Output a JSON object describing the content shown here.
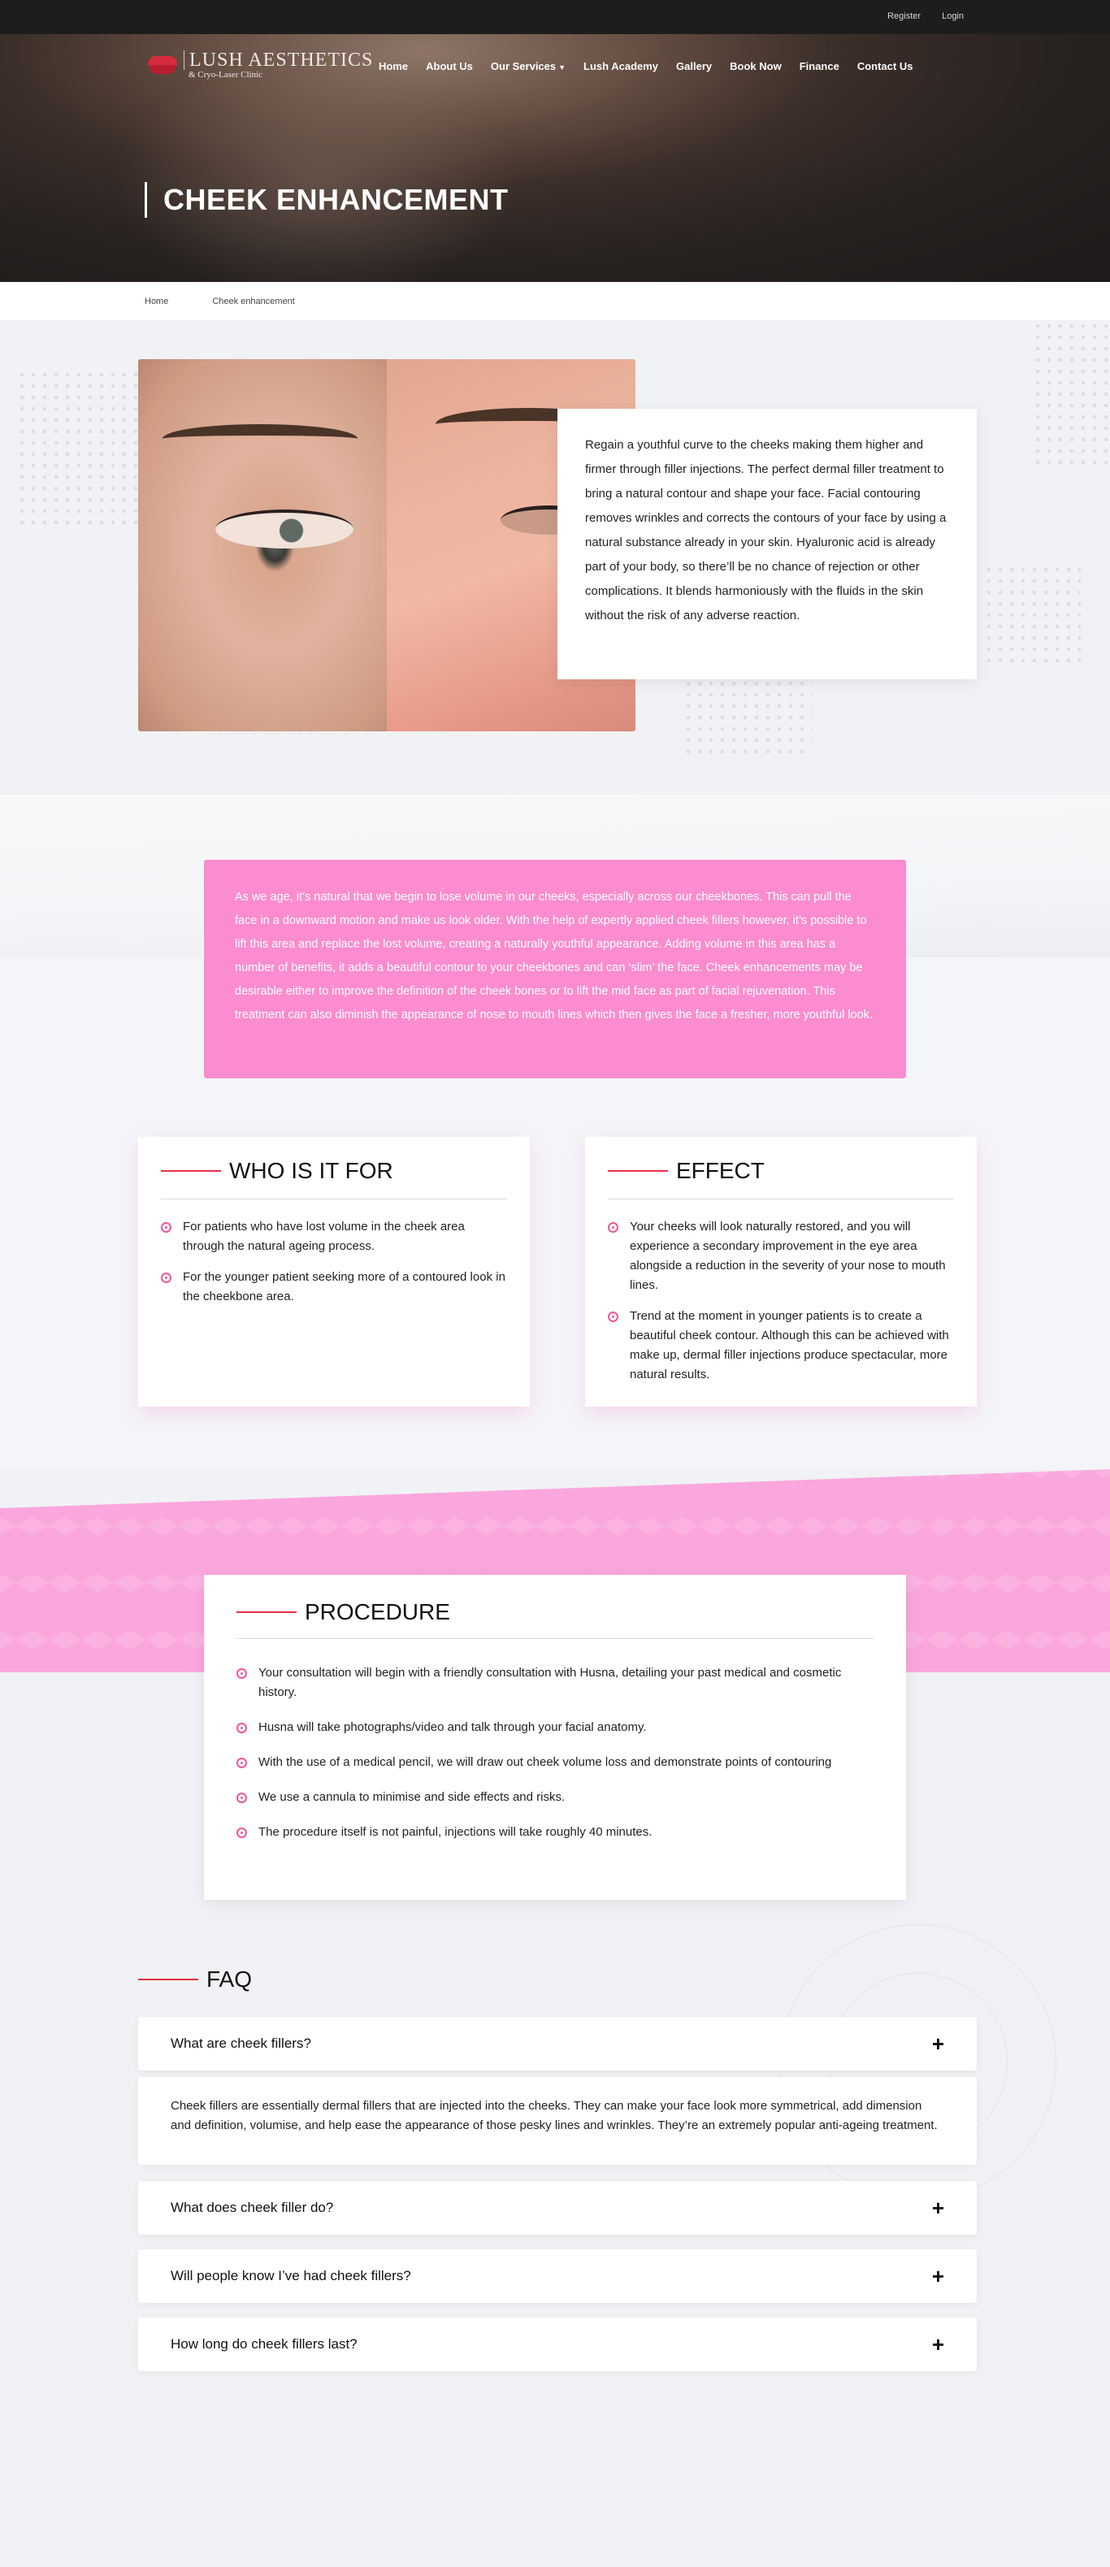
{
  "topbar": {
    "register": "Register",
    "login": "Login"
  },
  "logo": {
    "line1": "LUSH AESTHETICS",
    "line2": "& Cryo-Laser Clinic"
  },
  "nav": {
    "items": [
      "Home",
      "About Us",
      "Our Services",
      "Lush Academy",
      "Gallery",
      "Book Now",
      "Finance",
      "Contact Us"
    ],
    "dropdown_item": "Our Services"
  },
  "hero": {
    "title": "CHEEK ENHANCEMENT"
  },
  "breadcrumb": {
    "home": "Home",
    "current": "Cheek enhancement"
  },
  "intro": {
    "text": "Regain a youthful curve to the cheeks making them higher and firmer through filler injections. The perfect dermal filler treatment to bring a natural contour and shape your face. Facial contouring removes wrinkles and corrects the contours of your face by using a natural substance already in your skin. Hyaluronic acid is already part of your body, so there’ll be no chance of rejection or other complications. It blends harmoniously with the fluids in the skin without the risk of any adverse reaction."
  },
  "pink_info": {
    "text": "As we age, it’s natural that we begin to lose volume in our cheeks, especially across our cheekbones. This can pull the face in a downward motion and make us look older. With the help of expertly applied cheek fillers however, it’s possible to lift this area and replace the lost volume, creating a naturally youthful appearance. Adding volume in this area has a number of benefits, it adds a beautiful contour to your cheekbones and can ‘slim’ the face. Cheek enhancements may be desirable either to improve the definition of the cheek bones or to lift the mid face as part of facial rejuvenation. This treatment can also diminish the appearance of nose to mouth lines which then gives the face a fresher, more youthful look."
  },
  "who": {
    "title": "WHO IS IT FOR",
    "items": [
      "For patients who have lost volume in the cheek area through the natural ageing process.",
      "For the younger patient seeking more of a contoured look in the cheekbone area."
    ]
  },
  "effect": {
    "title": "EFFECT",
    "items": [
      "Your cheeks will look naturally restored, and you will experience a secondary improvement in the eye area alongside a reduction in the severity of your nose to mouth lines.",
      "Trend at the moment in younger patients is to create a beautiful cheek contour. Although this can be achieved with make up, dermal filler injections produce spectacular, more natural results."
    ]
  },
  "procedure": {
    "title": "PROCEDURE",
    "items": [
      "Your consultation will begin with a friendly consultation with Husna, detailing your past medical and cosmetic history.",
      "Husna will take photographs/video and talk through your facial anatomy.",
      "With the use of a medical pencil, we will draw out cheek volume loss and demonstrate points of contouring",
      "We use a cannula to minimise and side effects and risks.",
      "The procedure itself is not painful, injections will take roughly 40 minutes."
    ]
  },
  "faq": {
    "title": "FAQ",
    "items": [
      {
        "question": "What are cheek fillers?",
        "answer": "Cheek fillers are essentially dermal fillers that are injected into the cheeks. They can make your face look more symmetrical, add dimension and definition, volumise, and help ease the appearance of those pesky lines and wrinkles. They’re an extremely popular anti-ageing treatment."
      },
      {
        "question": "What does cheek filler do?"
      },
      {
        "question": "Will people know I’ve had cheek fillers?"
      },
      {
        "question": "How long do cheek fillers last?"
      }
    ],
    "toggle_icon": "+"
  },
  "colors": {
    "accent_red": "#e8304a",
    "pink": "#fb8ccf",
    "pink_light": "#fba7dd"
  }
}
